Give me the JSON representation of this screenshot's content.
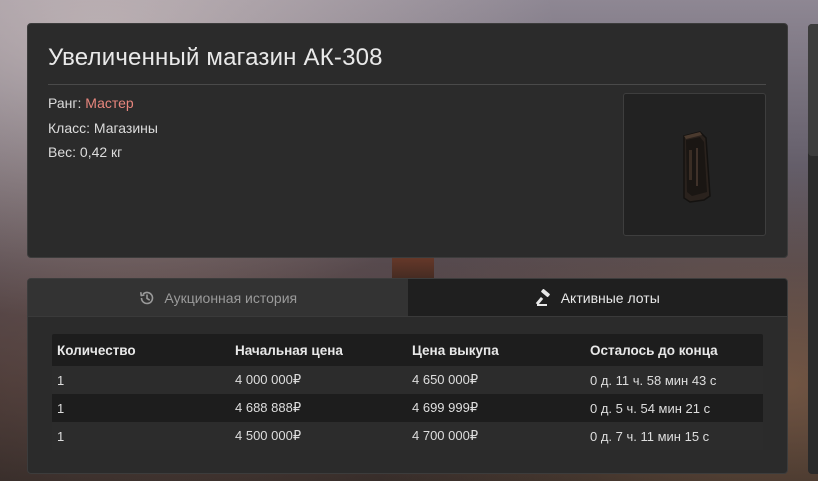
{
  "item": {
    "title": "Увеличенный магазин АК-308",
    "rank_label": "Ранг: ",
    "rank_value": "Мастер",
    "class_label": "Класс: ",
    "class_value": "Магазины",
    "weight_label": "Вес: ",
    "weight_value": "0,42 кг",
    "image_icon": "magazine-icon"
  },
  "tabs": {
    "history": {
      "label": "Аукционная история",
      "icon": "history-icon"
    },
    "active": {
      "label": "Активные лоты",
      "icon": "gavel-icon"
    }
  },
  "table": {
    "columns": [
      "Количество",
      "Начальная цена",
      "Цена выкупа",
      "Осталось до конца"
    ],
    "rows": [
      {
        "qty": "1",
        "start": "4 000 000₽",
        "buyout": "4 650 000₽",
        "left": "0 д. 11 ч. 58 мин 43 с"
      },
      {
        "qty": "1",
        "start": "4 688 888₽",
        "buyout": "4 699 999₽",
        "left": "0 д. 5 ч. 54 мин 21 с"
      },
      {
        "qty": "1",
        "start": "4 500 000₽",
        "buyout": "4 700 000₽",
        "left": "0 д. 7 ч. 11 мин 15 с"
      }
    ]
  },
  "colors": {
    "rank": "#e8867d",
    "panel": "#2b2b2b",
    "active_tab": "#1f1f1f"
  }
}
